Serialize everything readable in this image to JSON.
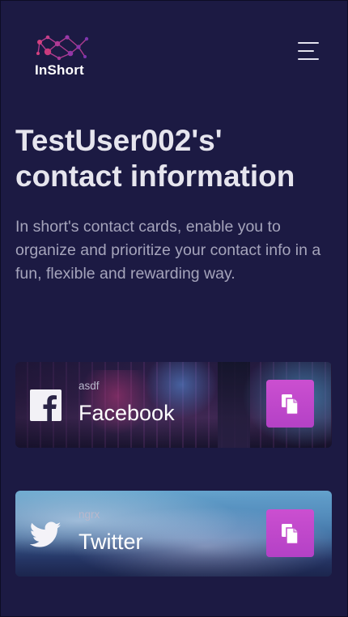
{
  "header": {
    "logo_text": "InShort",
    "menu_icon": "hamburger-menu-icon",
    "logo_colors": [
      "#c43f8a",
      "#8f3aa6"
    ]
  },
  "hero": {
    "title": "TestUser002's' contact information",
    "subtitle": "In short's contact cards, enable you to organize and prioritize your contact info in a fun, flexible and rewarding way."
  },
  "cards": [
    {
      "platform": "Facebook",
      "handle": "asdf",
      "icon": "facebook-icon",
      "copy_icon": "copy-icon"
    },
    {
      "platform": "Twitter",
      "handle": "ngrx",
      "icon": "twitter-icon",
      "copy_icon": "copy-icon"
    }
  ],
  "colors": {
    "background": "#1c1a43",
    "accent": "#c04ccc",
    "text": "#e6e5ee",
    "muted_text": "#a5a4bb"
  }
}
